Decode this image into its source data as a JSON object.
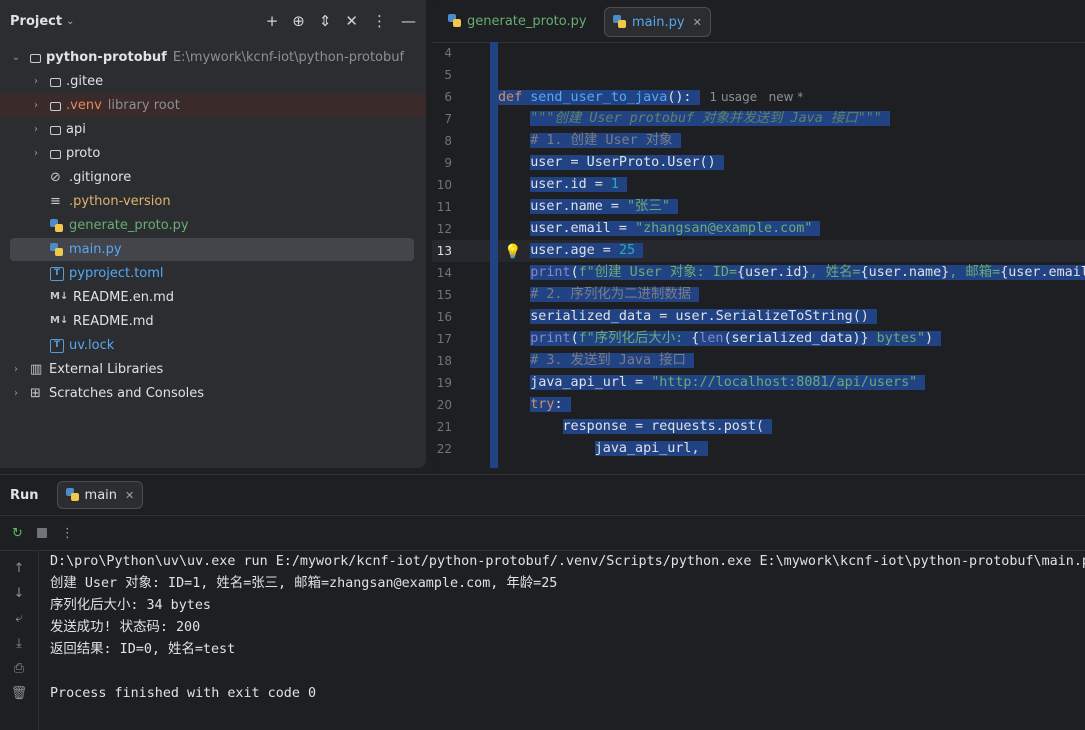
{
  "project": {
    "title": "Project",
    "tree": [
      {
        "name": "python-protobuf",
        "extra": "E:\\mywork\\kcnf-iot\\python-protobuf",
        "type": "folder",
        "expanded": true,
        "depth": 0,
        "bold": true
      },
      {
        "name": ".gitee",
        "type": "folder",
        "depth": 1
      },
      {
        "name": ".venv",
        "extra": "library root",
        "type": "folder",
        "depth": 1,
        "color": "#e48a5b"
      },
      {
        "name": "api",
        "type": "folder",
        "depth": 1
      },
      {
        "name": "proto",
        "type": "folder",
        "depth": 1
      },
      {
        "name": ".gitignore",
        "type": "ignore",
        "depth": 1
      },
      {
        "name": ".python-version",
        "type": "lines",
        "depth": 1,
        "color": "#e0b36e"
      },
      {
        "name": "generate_proto.py",
        "type": "py",
        "depth": 1,
        "color": "#6aab73"
      },
      {
        "name": "main.py",
        "type": "py",
        "depth": 1,
        "color": "#56a8f5",
        "selected": true
      },
      {
        "name": "pyproject.toml",
        "type": "toml",
        "depth": 1,
        "color": "#56a8f5"
      },
      {
        "name": "README.en.md",
        "type": "md",
        "depth": 1
      },
      {
        "name": "README.md",
        "type": "md",
        "depth": 1
      },
      {
        "name": "uv.lock",
        "type": "toml",
        "depth": 1,
        "color": "#56a8f5"
      },
      {
        "name": "External Libraries",
        "type": "lib",
        "depth": 0
      },
      {
        "name": "Scratches and Consoles",
        "type": "scratch",
        "depth": 0
      }
    ]
  },
  "editor": {
    "tabs": [
      {
        "label": "generate_proto.py",
        "color": "#6aab73",
        "active": false
      },
      {
        "label": "main.py",
        "color": "#56a8f5",
        "active": true
      }
    ],
    "current_line": "13",
    "lines": [
      {
        "n": "4",
        "html": ""
      },
      {
        "n": "5",
        "html": ""
      },
      {
        "n": "6",
        "html": "<span class='s'><span class='kw'>def </span><span class='fn'>send_user_to_java</span>():</span><span class='hint'>1 usage   new *</span>"
      },
      {
        "n": "7",
        "html": "    <span class='s'><span class='doc'>\"\"\"创建 User protobuf 对象并发送到 Java 接口\"\"\"</span></span>"
      },
      {
        "n": "8",
        "html": "    <span class='s'><span class='cmt'># 1. 创建 User 对象</span></span>"
      },
      {
        "n": "9",
        "html": "    <span class='s'>user = UserProto.User()</span>"
      },
      {
        "n": "10",
        "html": "    <span class='s'>user.id = <span class='num'>1</span></span>"
      },
      {
        "n": "11",
        "html": "    <span class='s'>user.name = <span class='str'>\"张三\"</span></span>"
      },
      {
        "n": "12",
        "html": "    <span class='s'>user.email = <span class='str'>\"zhangsan@example.com\"</span></span>"
      },
      {
        "n": "13",
        "html": "    <span class='s'>user.age = <span class='num'>25</span></span>"
      },
      {
        "n": "14",
        "html": "    <span class='s'><span class='bi'>print</span>(<span class='str'>f\"创建 User 对象: ID=</span>{user.id}<span class='str'>, 姓名=</span>{user.name}<span class='str'>, 邮箱=</span>{user.email}</span>"
      },
      {
        "n": "15",
        "html": "    <span class='s'><span class='cmt'># 2. 序列化为二进制数据</span></span>"
      },
      {
        "n": "16",
        "html": "    <span class='s'>serialized_data = user.SerializeToString()</span>"
      },
      {
        "n": "17",
        "html": "    <span class='s'><span class='bi'>print</span>(<span class='str'>f\"序列化后大小: </span>{<span class='bi'>len</span>(serialized_data)}<span class='str'> bytes\"</span>)</span>"
      },
      {
        "n": "18",
        "html": "    <span class='s'><span class='cmt'># 3. 发送到 Java 接口</span></span>"
      },
      {
        "n": "19",
        "html": "    <span class='s'>java_api_url = <span class='str'>\"http://localhost:8081/api/users\"</span></span>"
      },
      {
        "n": "20",
        "html": "    <span class='s'><span class='kw'>try</span>:</span>"
      },
      {
        "n": "21",
        "html": "        <span class='s'>response = requests.post(</span>"
      },
      {
        "n": "22",
        "html": "            <span class='s'>java_api_url,</span>"
      }
    ]
  },
  "run": {
    "title": "Run",
    "tab_label": "main",
    "output": [
      "D:\\pro\\Python\\uv\\uv.exe run E:/mywork/kcnf-iot/python-protobuf/.venv/Scripts/python.exe E:\\mywork\\kcnf-iot\\python-protobuf\\main.py",
      "创建 User 对象: ID=1, 姓名=张三, 邮箱=zhangsan@example.com, 年龄=25",
      "序列化后大小: 34 bytes",
      "发送成功! 状态码: 200",
      "返回结果: ID=0, 姓名=test",
      "",
      "Process finished with exit code 0"
    ]
  }
}
